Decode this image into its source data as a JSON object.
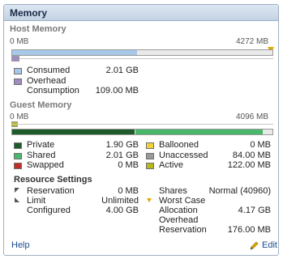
{
  "panel": {
    "title": "Memory"
  },
  "host_memory": {
    "title": "Host Memory",
    "axis_min": "0 MB",
    "axis_max": "4272 MB",
    "legend": [
      {
        "name": "consumed",
        "label": "Consumed",
        "value": "2.01 GB",
        "color": "#a8c8ea"
      },
      {
        "name": "overhead",
        "label": "Overhead",
        "value": "",
        "color": "#a08cbf"
      },
      {
        "name": "overhead-consumption",
        "label": "Consumption",
        "value": "109.00 MB",
        "color": ""
      }
    ],
    "consumed_fraction": 0.48,
    "overhead_fraction": 0.03
  },
  "guest_memory": {
    "title": "Guest Memory",
    "axis_min": "0 MB",
    "axis_max": "4096 MB",
    "legend_left": [
      {
        "name": "private",
        "label": "Private",
        "value": "1.90 GB",
        "color": "#1e5a2a"
      },
      {
        "name": "shared",
        "label": "Shared",
        "value": "2.01 GB",
        "color": "#49b86b"
      },
      {
        "name": "swapped",
        "label": "Swapped",
        "value": "0 MB",
        "color": "#c0302b"
      }
    ],
    "legend_right": [
      {
        "name": "ballooned",
        "label": "Ballooned",
        "value": "0 MB",
        "color": "#f0d23c"
      },
      {
        "name": "unaccessed",
        "label": "Unaccessed",
        "value": "84.00 MB",
        "color": "#9a9a9a"
      },
      {
        "name": "active",
        "label": "Active",
        "value": "122.00 MB",
        "color": "#b4b81e"
      }
    ],
    "private_fraction": 0.47,
    "shared_fraction": 0.49
  },
  "resource_settings": {
    "title": "Resource Settings",
    "left": [
      {
        "name": "reservation",
        "label": "Reservation",
        "value": "0 MB"
      },
      {
        "name": "limit",
        "label": "Limit",
        "value": "Unlimited"
      },
      {
        "name": "configured",
        "label": "Configured",
        "value": "4.00 GB"
      }
    ],
    "right": [
      {
        "name": "shares",
        "label": "Shares",
        "value": "Normal (40960)"
      },
      {
        "name": "worst-case",
        "label": "Worst Case",
        "value": ""
      },
      {
        "name": "allocation",
        "label": "Allocation",
        "value": "4.17 GB"
      },
      {
        "name": "overhead",
        "label": "Overhead",
        "value": ""
      },
      {
        "name": "overhead-reservation",
        "label": "Reservation",
        "value": "176.00 MB"
      }
    ]
  },
  "footer": {
    "help_label": "Help",
    "edit_label": "Edit"
  },
  "colors": {
    "accent_marker": "#e2a900",
    "link": "#1a4b8c"
  },
  "icons": {
    "edit": "pencil-edit-icon",
    "marker": "triangle-marker-icon"
  }
}
